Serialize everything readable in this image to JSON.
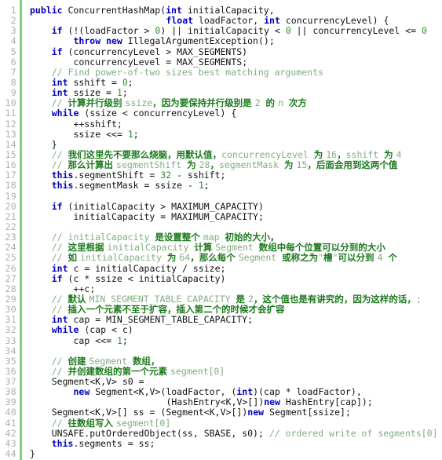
{
  "editor": {
    "language": "java",
    "background_color": "#ffffff",
    "gutter_color": "#b0b0b0",
    "gutter_rule_color": "#7ed47e",
    "total_lines": 44,
    "colors": {
      "keyword": "#0000c0",
      "number": "#2e8b2e",
      "comment_latin": "#7fae7f",
      "comment_cjk": "#1e7a1e",
      "text": "#111111"
    }
  },
  "line_numbers": [
    "1",
    "2",
    "3",
    "4",
    "5",
    "6",
    "7",
    "8",
    "9",
    "10",
    "11",
    "12",
    "13",
    "14",
    "15",
    "16",
    "17",
    "18",
    "19",
    "20",
    "21",
    "22",
    "23",
    "24",
    "25",
    "26",
    "27",
    "28",
    "29",
    "30",
    "31",
    "32",
    "33",
    "34",
    "35",
    "36",
    "37",
    "38",
    "39",
    "40",
    "41",
    "42",
    "43",
    "44"
  ],
  "code": {
    "lines": [
      {
        "n": 1,
        "text": "public ConcurrentHashMap(int initialCapacity,"
      },
      {
        "n": 2,
        "text": "                         float loadFactor, int concurrencyLevel) {"
      },
      {
        "n": 3,
        "text": "    if (!(loadFactor > 0) || initialCapacity < 0 || concurrencyLevel <= 0"
      },
      {
        "n": 4,
        "text": "        throw new IllegalArgumentException();"
      },
      {
        "n": 5,
        "text": "    if (concurrencyLevel > MAX_SEGMENTS)"
      },
      {
        "n": 6,
        "text": "        concurrencyLevel = MAX_SEGMENTS;"
      },
      {
        "n": 7,
        "text": "    // Find power-of-two sizes best matching arguments"
      },
      {
        "n": 8,
        "text": "    int sshift = 0;"
      },
      {
        "n": 9,
        "text": "    int ssize = 1;"
      },
      {
        "n": 10,
        "text": "    // 计算并行级别 ssize，因为要保持并行级别是 2 的 n 次方"
      },
      {
        "n": 11,
        "text": "    while (ssize < concurrencyLevel) {"
      },
      {
        "n": 12,
        "text": "        ++sshift;"
      },
      {
        "n": 13,
        "text": "        ssize <<= 1;"
      },
      {
        "n": 14,
        "text": "    }"
      },
      {
        "n": 15,
        "text": "    // 我们这里先不要那么烧脑，用默认值，concurrencyLevel 为 16，sshift 为 4"
      },
      {
        "n": 16,
        "text": "    // 那么计算出 segmentShift 为 28，segmentMask 为 15，后面会用到这两个值"
      },
      {
        "n": 17,
        "text": "    this.segmentShift = 32 - sshift;"
      },
      {
        "n": 18,
        "text": "    this.segmentMask = ssize - 1;"
      },
      {
        "n": 19,
        "text": ""
      },
      {
        "n": 20,
        "text": "    if (initialCapacity > MAXIMUM_CAPACITY)"
      },
      {
        "n": 21,
        "text": "        initialCapacity = MAXIMUM_CAPACITY;"
      },
      {
        "n": 22,
        "text": ""
      },
      {
        "n": 23,
        "text": "    // initialCapacity 是设置整个 map 初始的大小，"
      },
      {
        "n": 24,
        "text": "    // 这里根据 initialCapacity 计算 Segment 数组中每个位置可以分到的大小"
      },
      {
        "n": 25,
        "text": "    // 如 initialCapacity 为 64，那么每个 Segment 或称之为\"槽\"可以分到 4 个"
      },
      {
        "n": 26,
        "text": "    int c = initialCapacity / ssize;"
      },
      {
        "n": 27,
        "text": "    if (c * ssize < initialCapacity)"
      },
      {
        "n": 28,
        "text": "        ++c;"
      },
      {
        "n": 29,
        "text": "    // 默认 MIN_SEGMENT_TABLE_CAPACITY 是 2，这个值也是有讲究的，因为这样的话，;"
      },
      {
        "n": 30,
        "text": "    // 插入一个元素不至于扩容，插入第二个的时候才会扩容"
      },
      {
        "n": 31,
        "text": "    int cap = MIN_SEGMENT_TABLE_CAPACITY;"
      },
      {
        "n": 32,
        "text": "    while (cap < c)"
      },
      {
        "n": 33,
        "text": "        cap <<= 1;"
      },
      {
        "n": 34,
        "text": ""
      },
      {
        "n": 35,
        "text": "    // 创建 Segment 数组，"
      },
      {
        "n": 36,
        "text": "    // 并创建数组的第一个元素 segment[0]"
      },
      {
        "n": 37,
        "text": "    Segment<K,V> s0 ="
      },
      {
        "n": 38,
        "text": "        new Segment<K,V>(loadFactor, (int)(cap * loadFactor),"
      },
      {
        "n": 39,
        "text": "                         (HashEntry<K,V>[])new HashEntry[cap]);"
      },
      {
        "n": 40,
        "text": "    Segment<K,V>[] ss = (Segment<K,V>[])new Segment[ssize];"
      },
      {
        "n": 41,
        "text": "    // 往数组写入 segment[0]"
      },
      {
        "n": 42,
        "text": "    UNSAFE.putOrderedObject(ss, SBASE, s0); // ordered write of segments[0]"
      },
      {
        "n": 43,
        "text": "    this.segments = ss;"
      },
      {
        "n": 44,
        "text": "}"
      }
    ]
  }
}
